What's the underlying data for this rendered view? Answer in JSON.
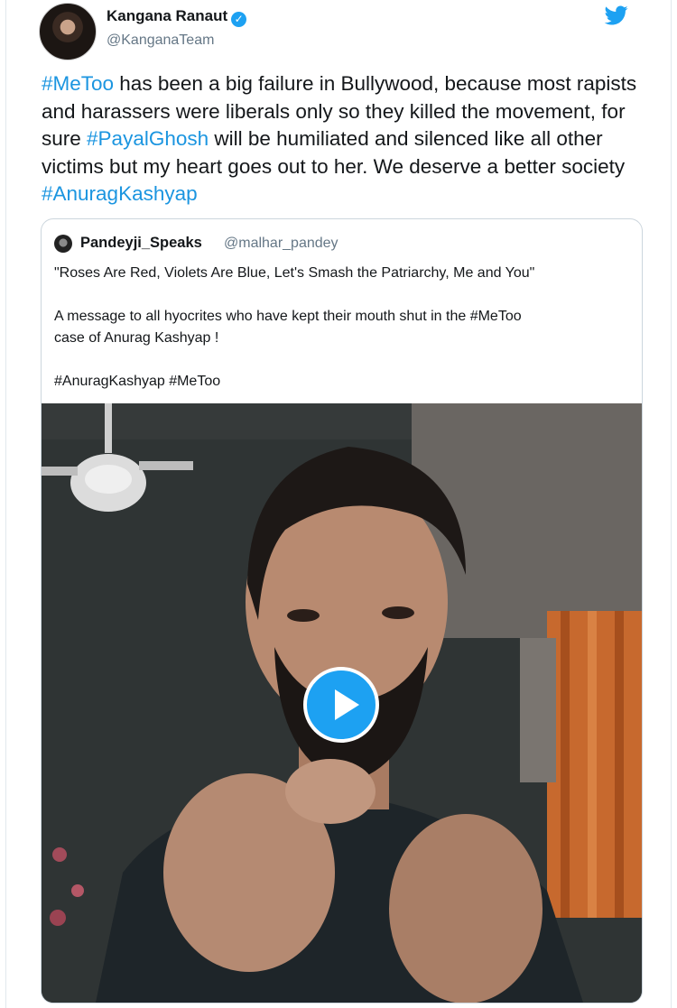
{
  "tweet": {
    "author_name": "Kangana Ranaut",
    "author_handle": "@KanganaTeam",
    "verified_mark": "✓",
    "text": [
      {
        "t": "#MeToo",
        "tag": true
      },
      {
        "t": " has been a big failure in Bullywood, because most rapists and harassers were liberals only so they killed the movement, for sure ",
        "tag": false
      },
      {
        "t": "#PayalGhosh",
        "tag": true
      },
      {
        "t": " will be humiliated and silenced like all other victims but my heart goes out to her. We deserve a better society ",
        "tag": false
      },
      {
        "t": "#AnuragKashyap",
        "tag": true
      }
    ]
  },
  "quoted_tweet": {
    "author_name": "Pandeyji_Speaks",
    "author_handle": "@malhar_pandey",
    "line1": "\"Roses Are Red, Violets Are Blue, Let's Smash the Patriarchy, Me and You\"",
    "line2": "A message to all hyocrites  who have kept their mouth shut in the #MeToo",
    "line3": "case of  Anurag Kashyap !",
    "line4": "#AnuragKashyap #MeToo"
  },
  "icons": {
    "logo": "twitter-bird-icon",
    "play": "play-icon"
  },
  "colors": {
    "accent": "#1da1f2",
    "hashtag": "#1b95e0",
    "secondary_text": "#657786",
    "border": "#ccd6dd"
  }
}
